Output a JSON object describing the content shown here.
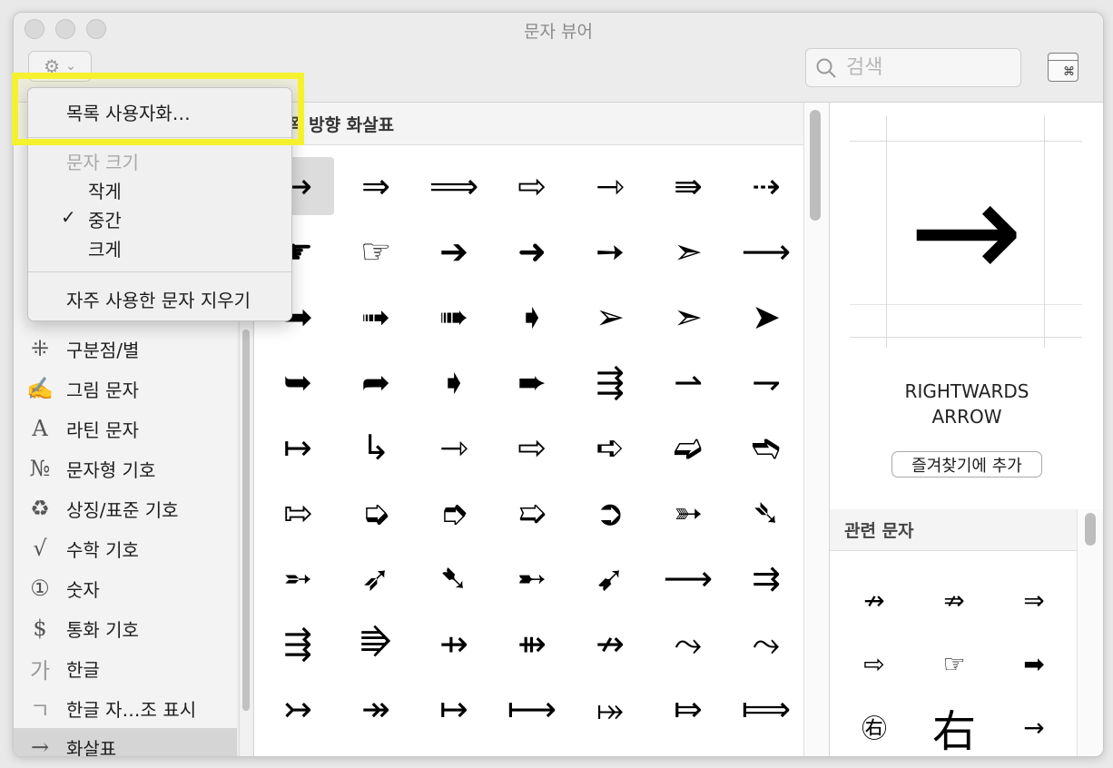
{
  "window": {
    "title": "문자 뷰어"
  },
  "toolbar": {
    "gear_caret": "⌄",
    "search_placeholder": "검색",
    "keyboard_icon_label": "⌘"
  },
  "menu": {
    "customize": "목록 사용자화…",
    "font_size_header": "문자 크기",
    "small": "작게",
    "medium": "중간",
    "large": "크게",
    "checkmark": "✓",
    "clear_recent": "자주 사용한 문자 지우기"
  },
  "sidebar": {
    "items": [
      {
        "icon": "⁜",
        "label": "구분점/별"
      },
      {
        "icon": "✍",
        "label": "그림 문자"
      },
      {
        "icon": "A",
        "label": "라틴 문자"
      },
      {
        "icon": "№",
        "label": "문자형 기호"
      },
      {
        "icon": "♻",
        "label": "상징/표준 기호"
      },
      {
        "icon": "√",
        "label": "수학 기호"
      },
      {
        "icon": "①",
        "label": "숫자"
      },
      {
        "icon": "$",
        "label": "통화 기호"
      },
      {
        "icon": "가",
        "label": "한글"
      },
      {
        "icon": "ㄱ",
        "label": "한글 자…조 표시"
      },
      {
        "icon": "→",
        "label": "화살표"
      }
    ]
  },
  "main": {
    "section_title": "쪽 방향 화살표",
    "grid": [
      [
        "→",
        "⇒",
        "⟹",
        "⇨",
        "⇾",
        "⇛",
        "⇢"
      ],
      [
        "☛",
        "☞",
        "➔",
        "➜",
        "➙",
        "➣",
        "⟶"
      ],
      [
        "➡",
        "➟",
        "➠",
        "➧",
        "➢",
        "➣",
        "➤"
      ],
      [
        "➥",
        "➦",
        "➧",
        "➨",
        "⇶",
        "⇀",
        "⇁"
      ],
      [
        "↦",
        "↳",
        "⇾",
        "⇨",
        "➪",
        "➫",
        "➬"
      ],
      [
        "⇰",
        "➭",
        "➮",
        "➯",
        "➲",
        "➳",
        "➴"
      ],
      [
        "➵",
        "➶",
        "➷",
        "➸",
        "➹",
        "⟶",
        "⇉"
      ],
      [
        "⇶",
        "⭆",
        "⇸",
        "⇻",
        "↛",
        "⤳",
        "⤳"
      ],
      [
        "↣",
        "↠",
        "↦",
        "⟼",
        "⤅",
        "⤇",
        "⟾"
      ]
    ]
  },
  "detail": {
    "glyph": "→",
    "name_line1": "RIGHTWARDS",
    "name_line2": "ARROW",
    "favorite_button": "즐겨찾기에 추가",
    "related_title": "관련 문자",
    "related": [
      "↛",
      "⇏",
      "⇒",
      "⇨",
      "☞",
      "➡",
      "㊨",
      "右",
      "→"
    ]
  }
}
